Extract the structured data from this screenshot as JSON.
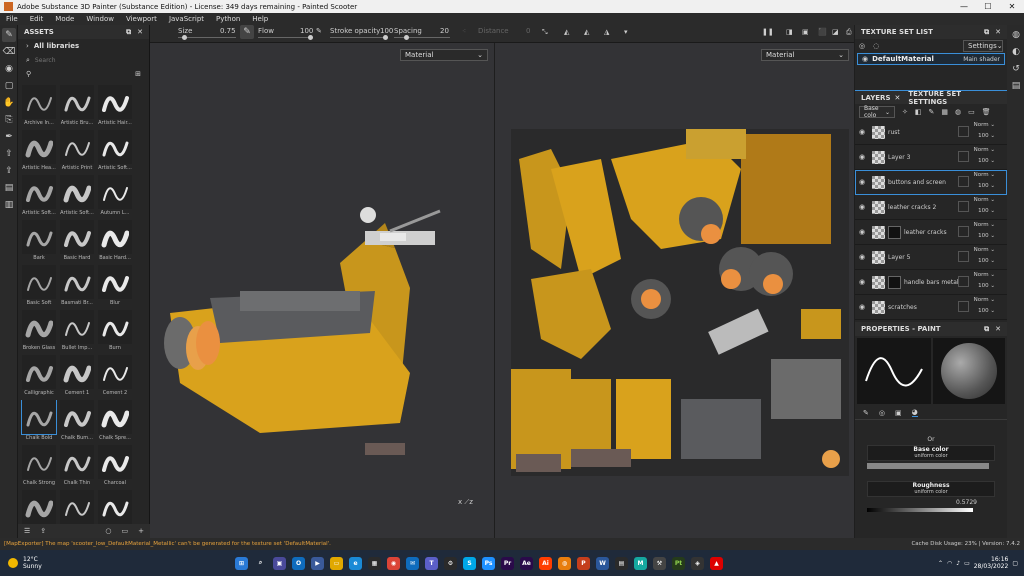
{
  "window": {
    "title": "Adobe Substance 3D Painter (Substance Edition) - License: 349 days remaining - Painted Scooter"
  },
  "menu": [
    "File",
    "Edit",
    "Mode",
    "Window",
    "Viewport",
    "JavaScript",
    "Python",
    "Help"
  ],
  "toolbar": {
    "size_label": "Size",
    "size_value": "0.75",
    "flow_label": "Flow",
    "flow_value": "100",
    "stroke_label": "Stroke opacity",
    "stroke_value": "100",
    "spacing_label": "Spacing",
    "spacing_value": "20",
    "distance_label": "Distance",
    "distance_value": "0"
  },
  "assets": {
    "title": "ASSETS",
    "library": "All libraries",
    "search_placeholder": "Search",
    "items": [
      "Archive In...",
      "Artistic Bru...",
      "Artistic Hair...",
      "Artistic Hea...",
      "Artistic Print",
      "Artistic Soft...",
      "Artistic Soft...",
      "Artistic Soft...",
      "Autumn L...",
      "Bark",
      "Basic Hard",
      "Basic Hard...",
      "Basic Soft",
      "Basmati Br...",
      "Blur",
      "Broken Glass",
      "Bullet Imp...",
      "Burn",
      "Calligraphic",
      "Cement 1",
      "Cement 2",
      "Chalk Bold",
      "Chalk Bum...",
      "Chalk Spre...",
      "Chalk Strong",
      "Chalk Thin",
      "Charcoal",
      "Charcoal Fi...",
      "Charcoal F...",
      "Charcoal Li..."
    ]
  },
  "viewport": {
    "left_dropdown": "Material",
    "right_dropdown": "Material"
  },
  "texture_set_list": {
    "title": "TEXTURE SET LIST",
    "settings": "Settings",
    "set_name": "DefaultMaterial",
    "shader": "Main shader"
  },
  "layers": {
    "tab_layers": "LAYERS",
    "tab_settings": "TEXTURE SET SETTINGS",
    "channel": "Base colo",
    "items": [
      {
        "name": "rust",
        "blend": "Norm",
        "opacity": "100"
      },
      {
        "name": "Layer 3",
        "blend": "Norm",
        "opacity": "100"
      },
      {
        "name": "buttons and screen",
        "blend": "Norm",
        "opacity": "100"
      },
      {
        "name": "leather cracks 2",
        "blend": "Norm",
        "opacity": "100"
      },
      {
        "name": "leather cracks",
        "blend": "Norm",
        "opacity": "100"
      },
      {
        "name": "Layer 5",
        "blend": "Norm",
        "opacity": "100"
      },
      {
        "name": "handle bars metal",
        "blend": "Norm",
        "opacity": "100"
      },
      {
        "name": "scratches",
        "blend": "Norm",
        "opacity": "100"
      }
    ]
  },
  "properties": {
    "title": "PROPERTIES - PAINT",
    "or": "Or",
    "base_color": "Base color",
    "base_color_sub": "uniform color",
    "roughness": "Roughness",
    "roughness_sub": "uniform color",
    "roughness_value": "0.5729"
  },
  "status": {
    "message": "[MapExporter] The map 'scooter_low_DefaultMaterial_Metallic' can't be generated for the texture set 'DefaultMaterial'.",
    "right": "Cache Disk Usage:   23%  |  Version: 7.4.2"
  },
  "taskbar": {
    "temp": "12°C",
    "weather": "Sunny",
    "time": "16:16",
    "date": "28/03/2022"
  },
  "colors": {
    "accent": "#3a8fd9",
    "scooter_yellow": "#d9a21c",
    "status_warn": "#e8a33d"
  }
}
